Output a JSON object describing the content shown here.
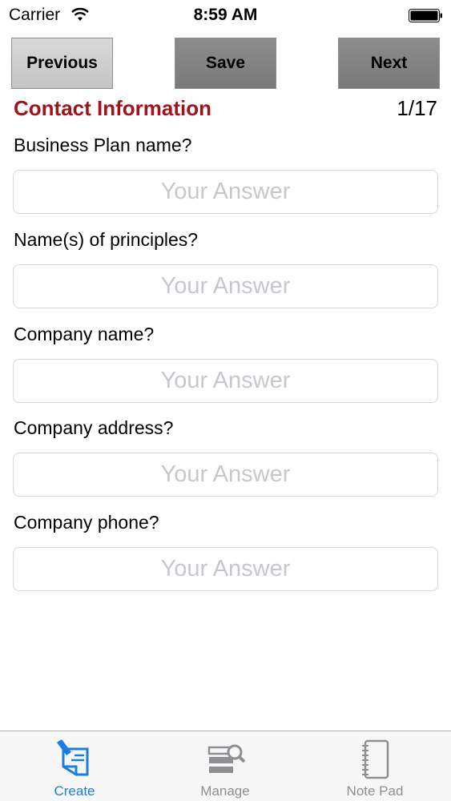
{
  "status_bar": {
    "carrier": "Carrier",
    "time": "8:59 AM"
  },
  "toolbar": {
    "previous_label": "Previous",
    "save_label": "Save",
    "next_label": "Next"
  },
  "section": {
    "title": "Contact Information",
    "page_indicator": "1/17"
  },
  "questions": [
    {
      "label": "Business Plan name?",
      "placeholder": "Your Answer",
      "value": ""
    },
    {
      "label": "Name(s) of principles?",
      "placeholder": "Your Answer",
      "value": ""
    },
    {
      "label": "Company name?",
      "placeholder": "Your Answer",
      "value": ""
    },
    {
      "label": "Company address?",
      "placeholder": "Your Answer",
      "value": ""
    },
    {
      "label": "Company phone?",
      "placeholder": "Your Answer",
      "value": ""
    }
  ],
  "tab_bar": {
    "tabs": [
      {
        "label": "Create",
        "icon": "create-document-icon",
        "active": true
      },
      {
        "label": "Manage",
        "icon": "manage-search-icon",
        "active": false
      },
      {
        "label": "Note Pad",
        "icon": "notepad-icon",
        "active": false
      }
    ]
  },
  "colors": {
    "section_title": "#a0141c",
    "active_tab": "#1a7ee0",
    "inactive_tab": "#8e8e93"
  }
}
